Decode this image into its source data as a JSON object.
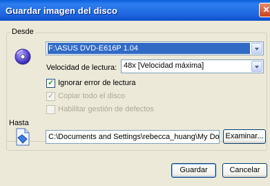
{
  "window": {
    "title": "Guardar imagen del disco",
    "close_glyph": "✕"
  },
  "source": {
    "group_label": "Desde",
    "drive": "F:\\ASUS DVD-E616P 1.04",
    "speed_label": "Velocidad de lectura:",
    "speed_value": "48x [Velocidad máxima]",
    "options": [
      {
        "label": "Ignorar error de lectura",
        "checked": true,
        "enabled": true
      },
      {
        "label": "Copiar todo el disco",
        "checked": true,
        "enabled": false
      },
      {
        "label": "Habilitar gestión de defectos",
        "checked": false,
        "enabled": false
      }
    ]
  },
  "destination": {
    "group_label": "Hasta",
    "path": "C:\\Documents and Settings\\rebecca_huang\\My Documents\\",
    "browse_label": "Examinar..."
  },
  "buttons": {
    "save": "Guardar",
    "cancel": "Cancelar"
  }
}
